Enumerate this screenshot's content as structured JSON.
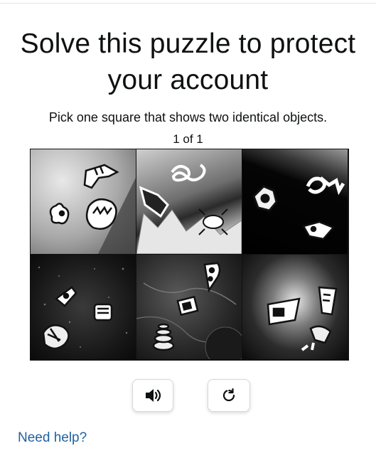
{
  "title": "Solve this puzzle to protect your account",
  "instruction": "Pick one square that shows two identical objects.",
  "counter": "1 of 1",
  "puzzle": {
    "tiles": [
      {
        "name": "tile-1",
        "icons": [
          "fish-icon",
          "bird-icon",
          "crown-face-icon"
        ]
      },
      {
        "name": "tile-2",
        "icons": [
          "knot-icon",
          "boot-icon",
          "beetle-icon"
        ]
      },
      {
        "name": "tile-3",
        "icons": [
          "chain-link-icon",
          "hexagon-nut-icon",
          "tag-icon"
        ]
      },
      {
        "name": "tile-4",
        "icons": [
          "rocket-icon",
          "dispenser-icon",
          "shell-icon"
        ]
      },
      {
        "name": "tile-5",
        "icons": [
          "pizza-slice-icon",
          "card-icon",
          "coil-icon"
        ]
      },
      {
        "name": "tile-6",
        "icons": [
          "flag-icon",
          "cup-icon",
          "tower-icon"
        ]
      }
    ]
  },
  "buttons": {
    "audio": {
      "icon": "speaker-icon"
    },
    "refresh": {
      "icon": "refresh-icon"
    }
  },
  "help_link": "Need help?",
  "colors": {
    "link": "#2162a1",
    "text": "#0f1111",
    "border": "#d5d9d9"
  }
}
